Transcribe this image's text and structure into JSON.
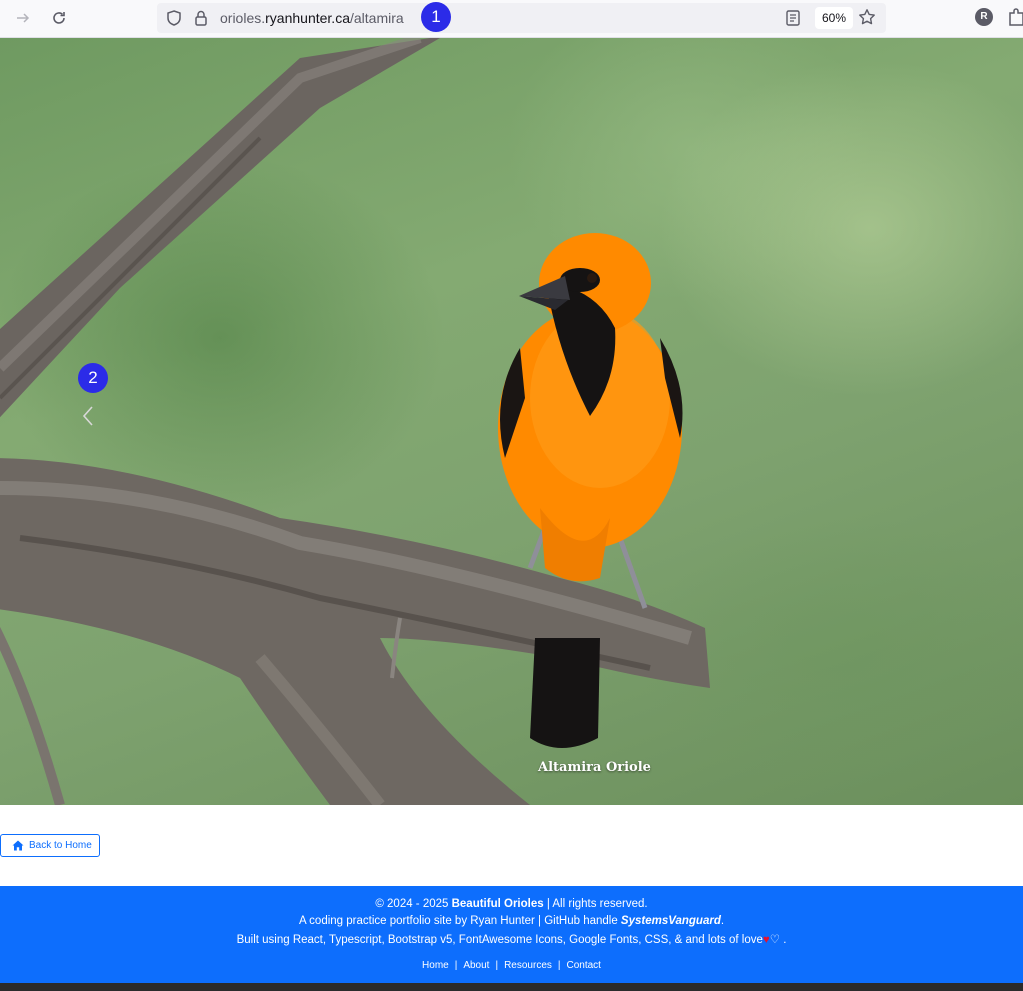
{
  "browser": {
    "url_prefix": "orioles.",
    "url_host": "ryanhunter.ca",
    "url_path": "/altamira",
    "zoom": "60%",
    "profile_initial": "R"
  },
  "badges": {
    "first": "1",
    "second": "2"
  },
  "carousel": {
    "caption": "Altamira Oriole"
  },
  "actions": {
    "back_label": "Back to Home"
  },
  "footer": {
    "line1_pre": "© 2024 - 2025 ",
    "line1_brand": "Beautiful Orioles",
    "line1_post": " | All rights reserved.",
    "line2_pre": "A coding practice portfolio site by Ryan Hunter | GitHub handle ",
    "line2_handle": "SystemsVanguard",
    "line2_post": ".",
    "line3_pre": "Built using React, Typescript, Bootstrap v5, FontAwesome Icons, Google Fonts, CSS, & and lots of love",
    "line3_heart": "♥",
    "line3_outline_heart": "♡",
    "line3_post": " .",
    "links": [
      "Home",
      "About",
      "Resources",
      "Contact"
    ]
  },
  "colors": {
    "primary": "#0d6efd",
    "badge": "#2b2be8",
    "oriole_orange": "#ff8a00"
  },
  "icons": [
    "forward-icon",
    "reload-icon",
    "shield-icon",
    "lock-icon",
    "reader-view-icon",
    "star-icon",
    "extensions-icon",
    "chevron-left-icon",
    "home-icon",
    "heart-icon"
  ]
}
